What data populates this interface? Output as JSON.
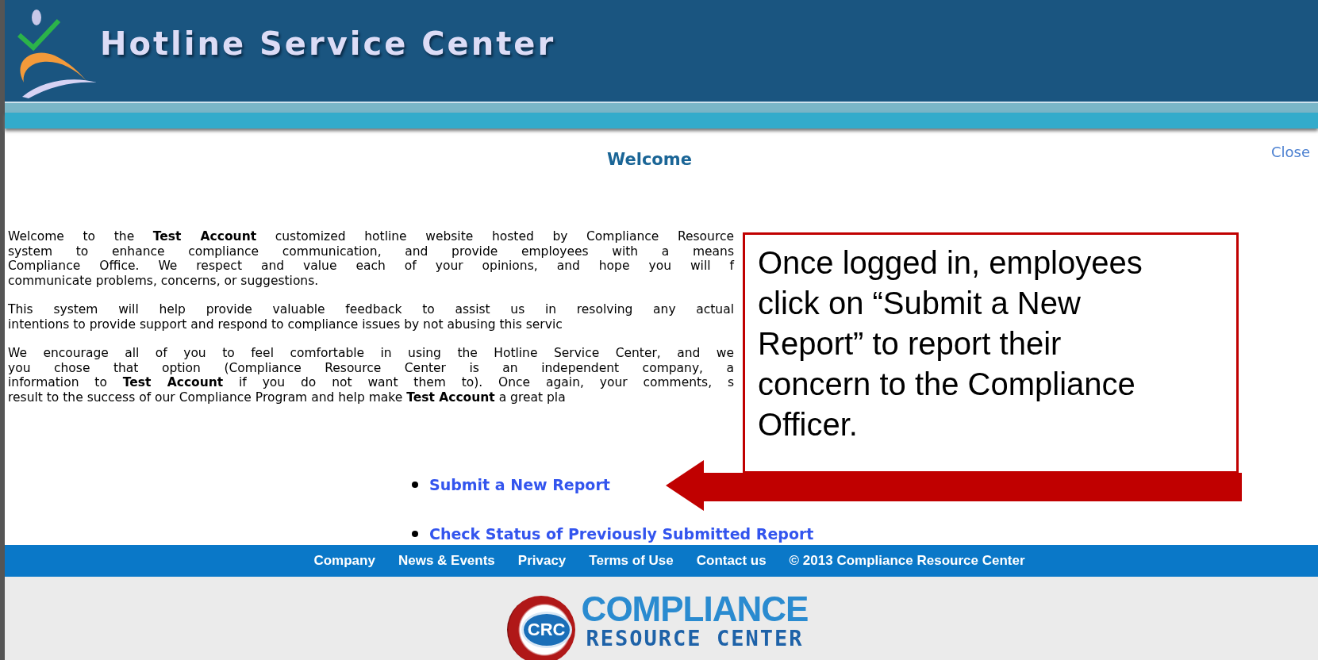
{
  "header": {
    "title": "Hotline Service Center"
  },
  "heading": "Welcome",
  "close_link": "Close",
  "paragraphs": [
    {
      "lines": [
        "Welcome to the **Test Account** customized hotline website hosted by Compliance Resource",
        "system to enhance compliance communication, and provide employees with a means",
        "Compliance Office. We respect and value each of your opinions, and hope you will f",
        "communicate problems, concerns, or suggestions."
      ]
    },
    {
      "lines": [
        "This system will help provide valuable feedback to assist us in resolving any actual",
        "intentions to provide support and respond to compliance issues by not abusing this servic"
      ]
    },
    {
      "lines": [
        "We encourage all of you to feel comfortable in using the Hotline Service Center, and we",
        "you chose that option (Compliance Resource Center is an independent company, a",
        "information to **Test Account** if you do not want them to). Once again, your comments, s",
        "result to the success of our Compliance Program and help make **Test Account** a great pla"
      ]
    }
  ],
  "links": [
    "Submit a New Report",
    "Check Status of Previously Submitted Report"
  ],
  "callout": {
    "text": "Once logged in, employees click on “Submit a New Report” to report their concern to the Compliance Officer."
  },
  "footer": {
    "links": [
      "Company",
      "News & Events",
      "Privacy",
      "Terms of Use",
      "Contact us"
    ],
    "copyright": "© 2013 Compliance Resource Center"
  },
  "logo": {
    "mark": "CRC",
    "name": "COMPLIANCE",
    "subtitle": "RESOURCE CENTER"
  }
}
